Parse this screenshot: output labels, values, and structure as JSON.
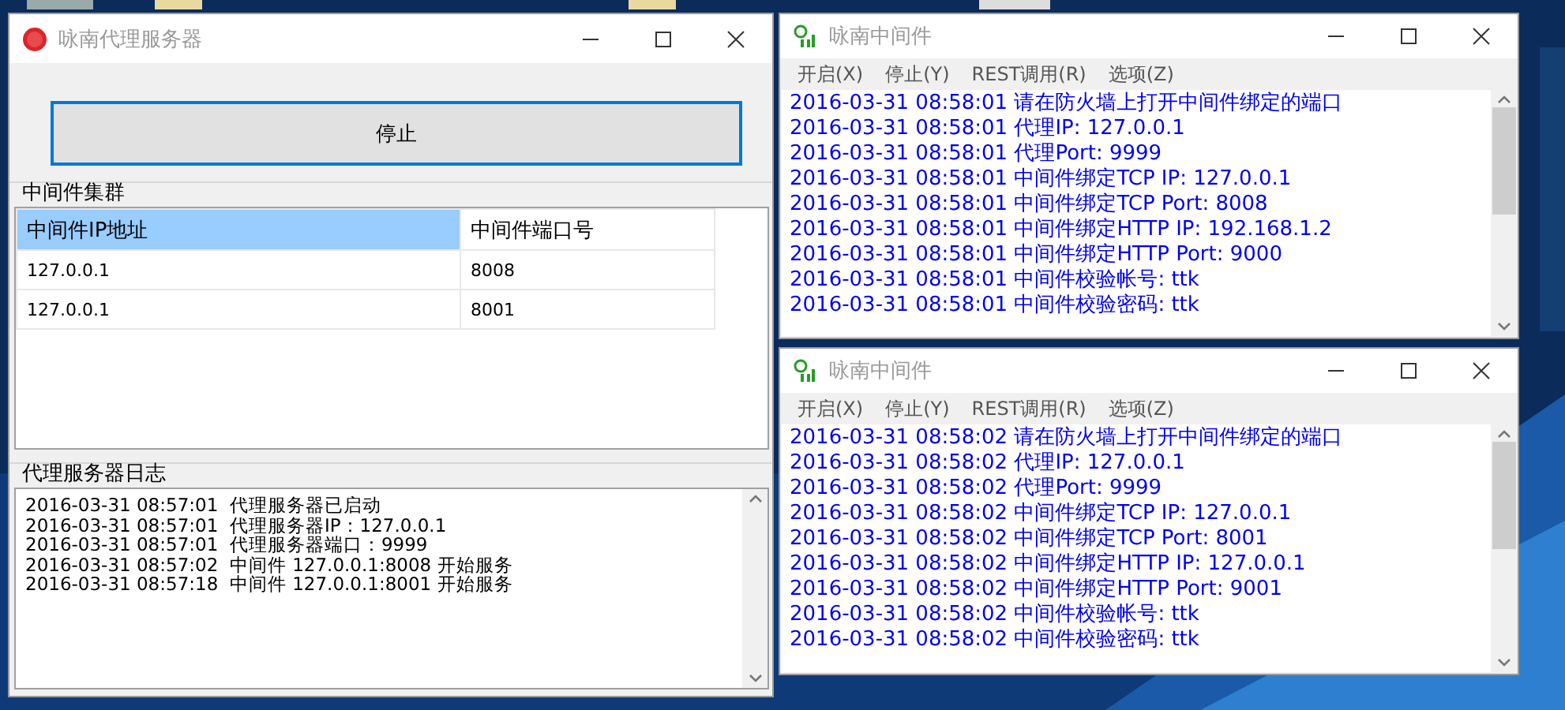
{
  "proxy_window": {
    "title": "咏南代理服务器",
    "stop_button": "停止",
    "cluster": {
      "label": "中间件集群",
      "columns": [
        {
          "label": "中间件IP地址",
          "selected": true
        },
        {
          "label": "中间件端口号",
          "selected": false
        }
      ],
      "rows": [
        [
          "127.0.0.1",
          "8008"
        ],
        [
          "127.0.0.1",
          "8001"
        ]
      ]
    },
    "log": {
      "label": "代理服务器日志",
      "lines": [
        "2016-03-31 08:57:01  代理服务器已启动",
        "2016-03-31 08:57:01  代理服务器IP：127.0.0.1",
        "2016-03-31 08:57:01  代理服务器端口：9999",
        "2016-03-31 08:57:02  中间件 127.0.0.1:8008 开始服务",
        "2016-03-31 08:57:18  中间件 127.0.0.1:8001 开始服务"
      ]
    }
  },
  "middleware_windows": [
    {
      "title": "咏南中间件",
      "menu": [
        "开启(X)",
        "停止(Y)",
        "REST调用(R)",
        "选项(Z)"
      ],
      "log": [
        "2016-03-31 08:58:01 请在防火墙上打开中间件绑定的端口",
        "2016-03-31 08:58:01 代理IP: 127.0.0.1",
        "2016-03-31 08:58:01 代理Port: 9999",
        "2016-03-31 08:58:01 中间件绑定TCP IP: 127.0.0.1",
        "2016-03-31 08:58:01 中间件绑定TCP Port: 8008",
        "2016-03-31 08:58:01 中间件绑定HTTP IP: 192.168.1.2",
        "2016-03-31 08:58:01 中间件绑定HTTP Port: 9000",
        "2016-03-31 08:58:01 中间件校验帐号: ttk",
        "2016-03-31 08:58:01 中间件校验密码: ttk"
      ]
    },
    {
      "title": "咏南中间件",
      "menu": [
        "开启(X)",
        "停止(Y)",
        "REST调用(R)",
        "选项(Z)"
      ],
      "log": [
        "2016-03-31 08:58:02 请在防火墙上打开中间件绑定的端口",
        "2016-03-31 08:58:02 代理IP: 127.0.0.1",
        "2016-03-31 08:58:02 代理Port: 9999",
        "2016-03-31 08:58:02 中间件绑定TCP IP: 127.0.0.1",
        "2016-03-31 08:58:02 中间件绑定TCP Port: 8001",
        "2016-03-31 08:58:02 中间件绑定HTTP IP: 127.0.0.1",
        "2016-03-31 08:58:02 中间件绑定HTTP Port: 9001",
        "2016-03-31 08:58:02 中间件校验帐号: ttk",
        "2016-03-31 08:58:02 中间件校验密码: ttk"
      ]
    }
  ]
}
